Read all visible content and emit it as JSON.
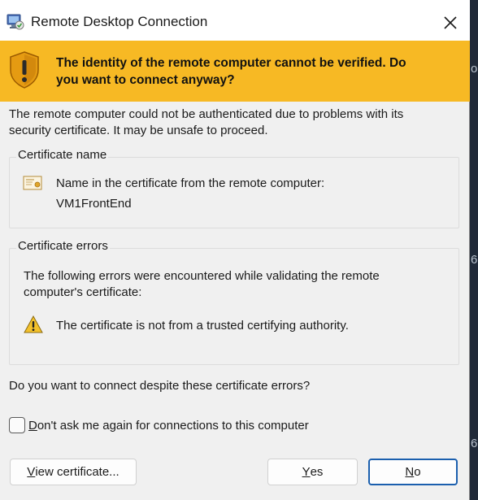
{
  "window": {
    "title": "Remote Desktop Connection",
    "app_icon": "remote-desktop-icon",
    "close_icon": "close-icon"
  },
  "banner": {
    "icon": "shield-warning-icon",
    "line1": "The identity of the remote computer cannot be verified. Do",
    "line2": "you want to connect anyway?",
    "color": "#f7b924"
  },
  "intro": {
    "line1": "The remote computer could not be authenticated due to problems with its",
    "line2": "security certificate. It may be unsafe to proceed."
  },
  "certificate_name": {
    "legend": "Certificate name",
    "icon": "certificate-icon",
    "label": "Name in the certificate from the remote computer:",
    "value": "VM1FrontEnd"
  },
  "certificate_errors": {
    "legend": "Certificate errors",
    "intro_line1": "The following errors were encountered while validating the remote",
    "intro_line2": "computer's certificate:",
    "icon": "warning-icon",
    "items": [
      "The certificate is not from a trusted certifying authority."
    ]
  },
  "question": "Do you want to connect despite these certificate errors?",
  "checkbox": {
    "label_first": "D",
    "label_rest": "on't ask me again for connections to this computer",
    "checked": false
  },
  "buttons": {
    "view_first": "V",
    "view_rest": "iew certificate...",
    "yes_first": "Y",
    "yes_rest": "es",
    "no_first": "N",
    "no_rest": "o"
  },
  "background": {
    "char1": "o",
    "char2": "6",
    "char3": "6"
  },
  "colors": {
    "accent": "#1b5fae",
    "dialog_bg": "#f0f0f0"
  }
}
